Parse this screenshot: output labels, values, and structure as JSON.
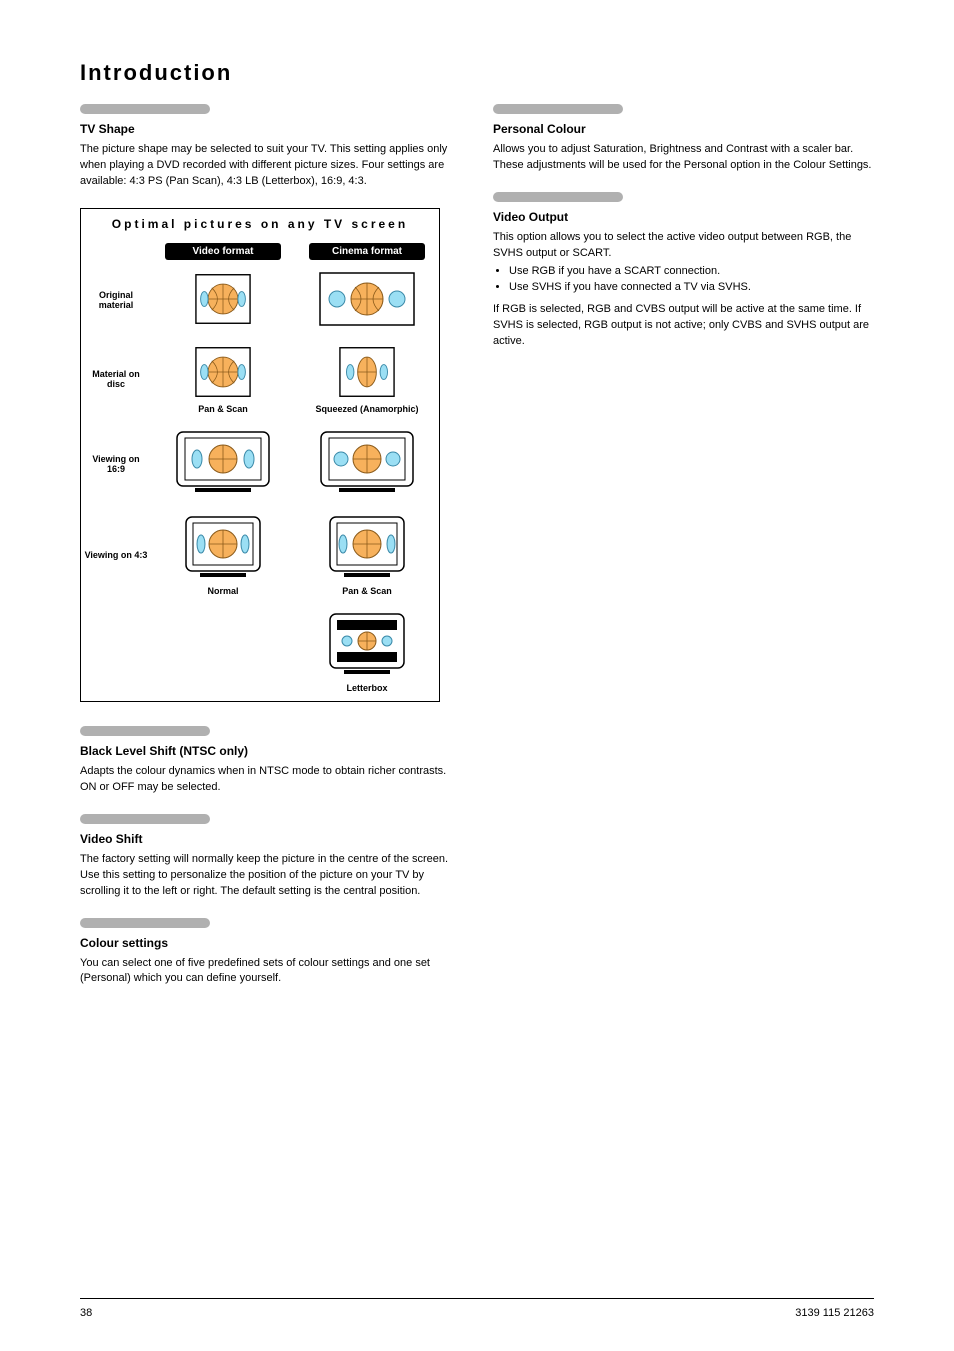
{
  "title": "Introduction",
  "col1": {
    "s1": {
      "head": "TV Shape",
      "body": "The picture shape may be selected to suit your TV. This setting applies only when playing a DVD recorded with different picture sizes. Four settings are available: 4:3 PS (Pan Scan), 4:3 LB (Letterbox), 16:9, 4:3."
    },
    "diagram": {
      "title": "Optimal pictures on any TV screen",
      "colHead1": "Video format",
      "colHead2": "Cinema format",
      "row1": "Original material",
      "row2": "Material on disc",
      "row2c1": "Pan & Scan",
      "row2c2": "Squeezed (Anamorphic)",
      "row3": "Viewing on 16:9",
      "row4": "Viewing on 4:3",
      "row4c1": "Normal",
      "row4c2a": "Pan & Scan",
      "row4c2b": "Letterbox"
    },
    "s2": {
      "head": "Black Level Shift (NTSC only)",
      "body": "Adapts the colour dynamics when in NTSC mode to obtain richer contrasts. ON or OFF may be selected."
    },
    "s3": {
      "head": "Video Shift",
      "body": "The factory setting will normally keep the picture in the centre of the screen. Use this setting to personalize the position of the picture on your TV by scrolling it to the left or right. The default setting is the central position."
    },
    "s4": {
      "head": "Colour settings",
      "body": "You can select one of five predefined sets of colour settings and one set (Personal) which you can define yourself."
    }
  },
  "col2": {
    "s1": {
      "head": "Personal Colour",
      "body": "Allows you to adjust Saturation, Brightness and Contrast with a scaler bar. These adjustments will be used for the Personal option in the Colour Settings."
    },
    "s2": {
      "head": "Video Output",
      "body": "This option allows you to select the active video output between RGB, the SVHS output or SCART.",
      "list": [
        "Use RGB if you have a SCART connection.",
        "Use SVHS if you have connected a TV via SVHS."
      ],
      "tail": "If RGB is selected, RGB and CVBS output will be active at the same time. If SVHS is selected, RGB output is not active; only CVBS and SVHS output are active."
    }
  },
  "footer": {
    "left": "38",
    "right": "3139 115 21263"
  }
}
